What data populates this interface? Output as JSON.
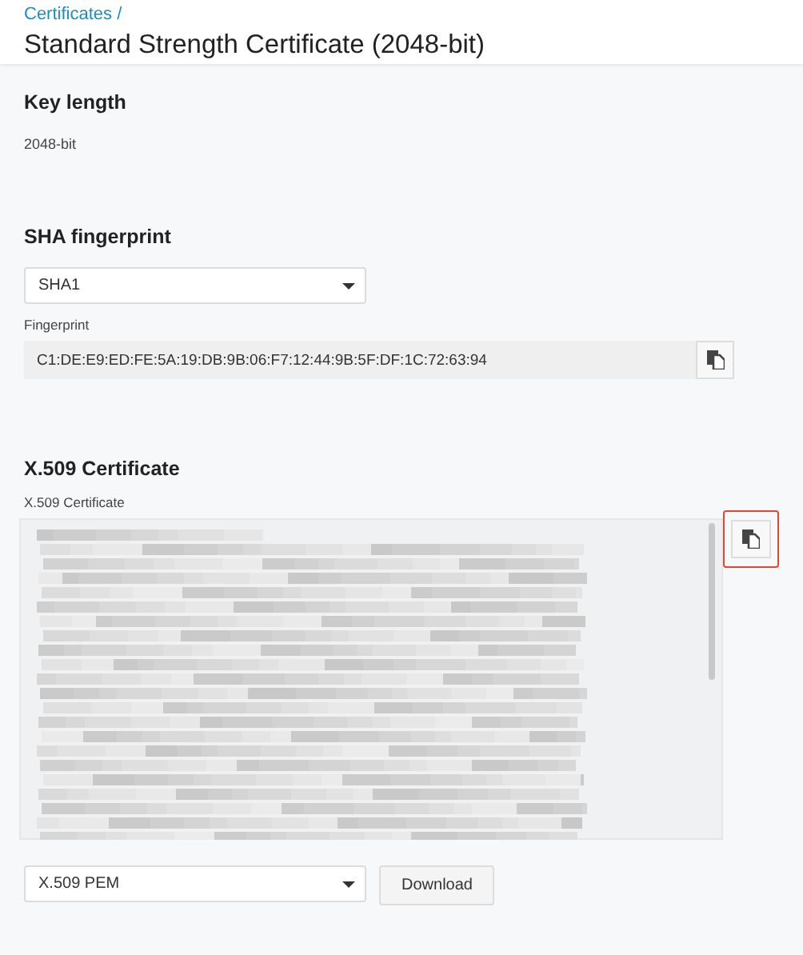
{
  "breadcrumb": "Certificates /",
  "title": "Standard Strength Certificate (2048-bit)",
  "key_length": {
    "heading": "Key length",
    "value": "2048-bit"
  },
  "sha_fingerprint": {
    "heading": "SHA fingerprint",
    "algorithm_select": "SHA1",
    "field_label": "Fingerprint",
    "value": "C1:DE:E9:ED:FE:5A:19:DB:9B:06:F7:12:44:9B:5F:DF:1C:72:63:94"
  },
  "certificate": {
    "heading": "X.509 Certificate",
    "field_label": "X.509 Certificate",
    "copy_button_highlighted": true,
    "format_select": "X.509 PEM",
    "download_button": "Download"
  }
}
